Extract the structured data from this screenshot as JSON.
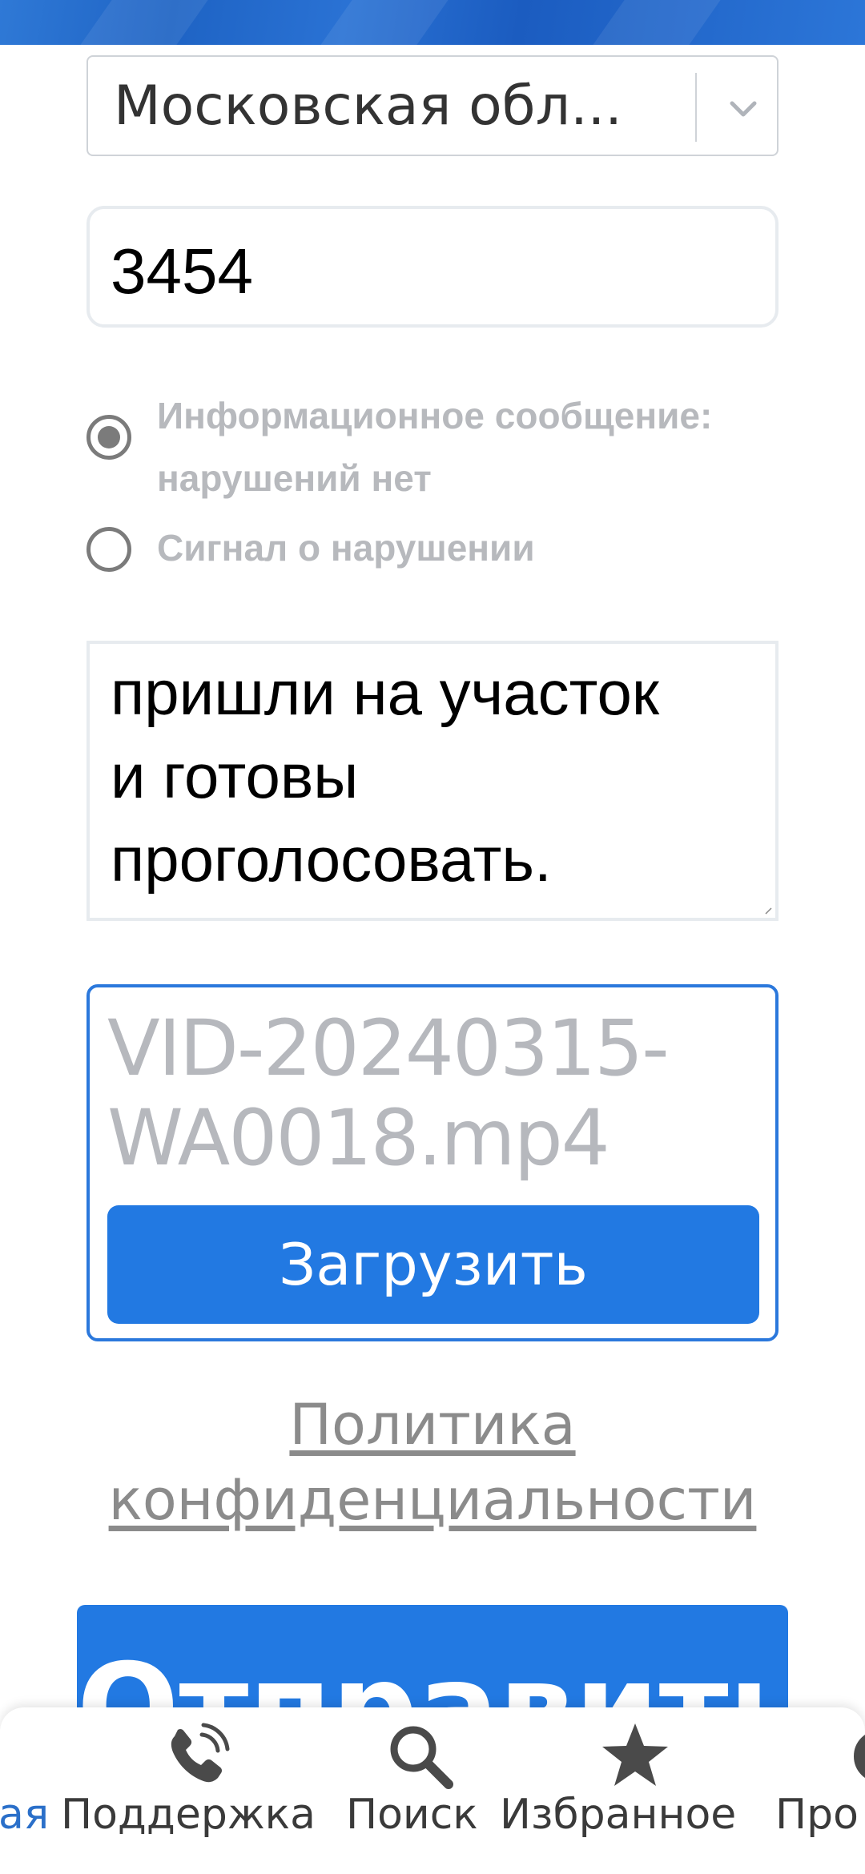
{
  "region_select": {
    "value": "Московская обл..."
  },
  "station_number": {
    "value": "3454"
  },
  "report_type": {
    "options": [
      {
        "label": "Информационное сообщение: нарушений нет",
        "selected": true
      },
      {
        "label": "Сигнал о нарушении",
        "selected": false
      }
    ]
  },
  "comment": {
    "visible_text": "ые избиратели уже\nпришли на участок\nи готовы\nпроголосовать."
  },
  "upload": {
    "filename": "VID-20240315-WA0018.mp4",
    "button_label": "Загрузить"
  },
  "privacy_link": {
    "label": "Политика конфиденциальности"
  },
  "submit": {
    "label": "Отправить"
  },
  "bottom_nav": {
    "items": [
      {
        "label": "ая",
        "icon": "home-icon",
        "active": true
      },
      {
        "label": "Поддержка",
        "icon": "phone-icon",
        "active": false
      },
      {
        "label": "Поиск",
        "icon": "search-icon",
        "active": false
      },
      {
        "label": "Избранное",
        "icon": "star-icon",
        "active": false
      },
      {
        "label": "Про",
        "icon": "gear-icon",
        "active": false
      }
    ]
  },
  "colors": {
    "accent": "#2279e2",
    "header": "#1e63c4",
    "muted_text": "#b7b9bd"
  }
}
